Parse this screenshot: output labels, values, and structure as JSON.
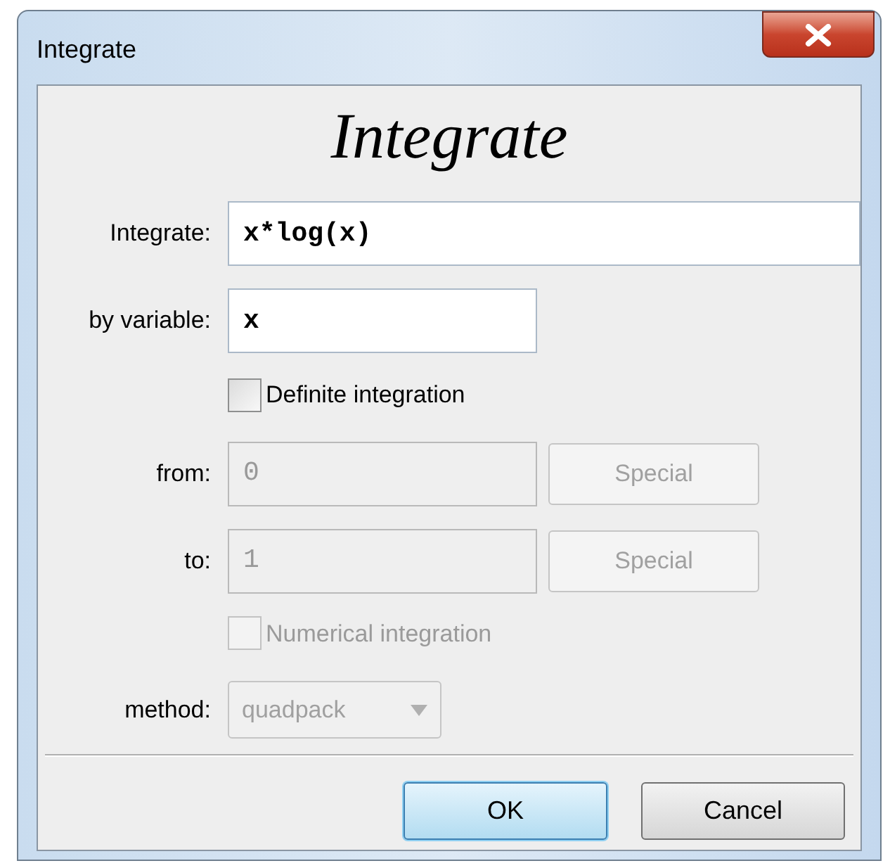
{
  "window": {
    "title": "Integrate"
  },
  "heading": "Integrate",
  "expression": {
    "label": "Integrate:",
    "value": "x*log(x)"
  },
  "variable": {
    "label": "by variable:",
    "value": "x"
  },
  "definite": {
    "label": "Definite integration",
    "checked": false,
    "disabled": false
  },
  "limits": [
    {
      "label": "from:",
      "value": "0",
      "button": "Special",
      "disabled": true
    },
    {
      "label": "to:",
      "value": "1",
      "button": "Special",
      "disabled": true
    }
  ],
  "numerical": {
    "label": "Numerical integration",
    "checked": false,
    "disabled": true
  },
  "method": {
    "label": "method:",
    "value": "quadpack",
    "disabled": true
  },
  "buttons": [
    {
      "label": "OK",
      "default": true
    },
    {
      "label": "Cancel",
      "default": false
    }
  ]
}
